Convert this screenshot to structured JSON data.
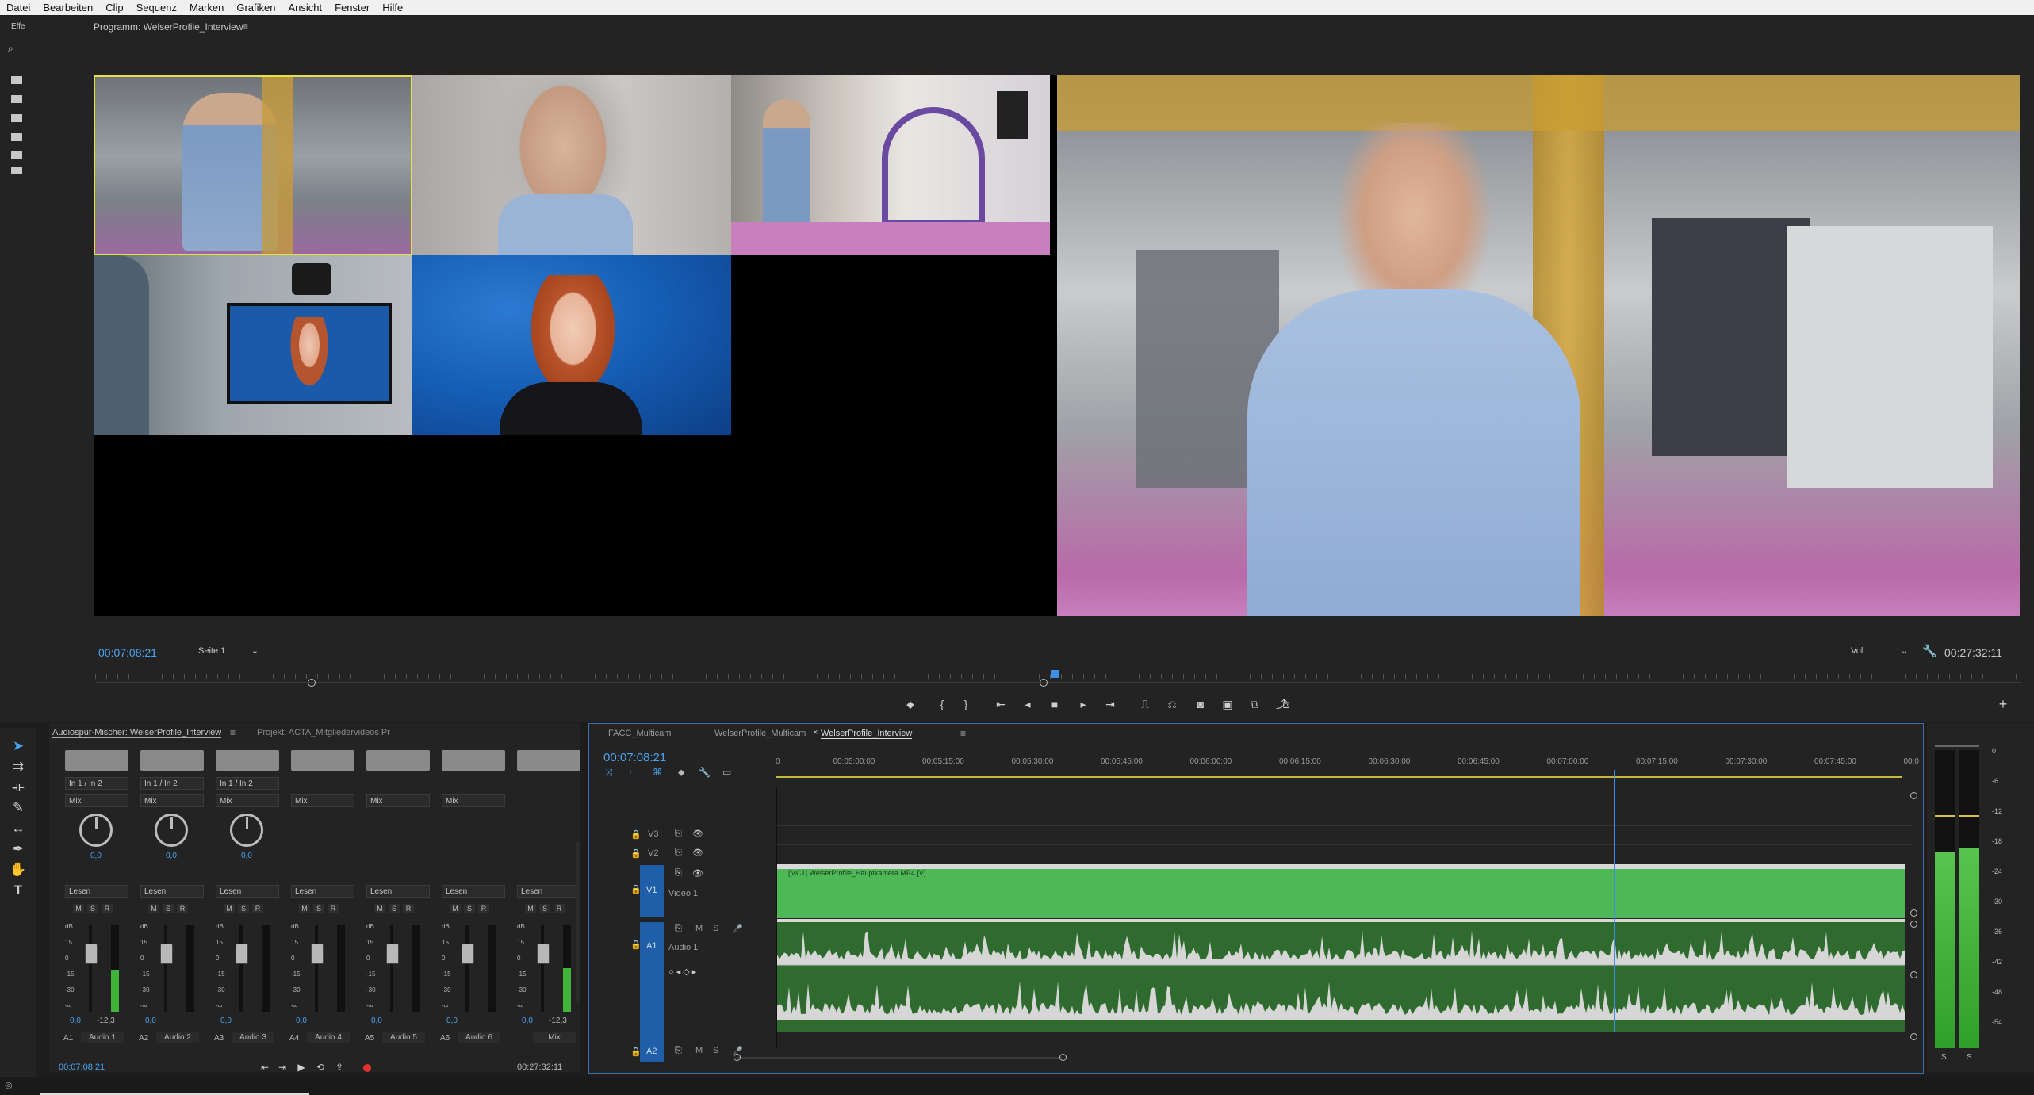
{
  "menu": [
    "Datei",
    "Bearbeiten",
    "Clip",
    "Sequenz",
    "Marken",
    "Grafiken",
    "Ansicht",
    "Fenster",
    "Hilfe"
  ],
  "left_panel": {
    "tab_label": "Effe"
  },
  "program_monitor": {
    "title": "Programm: WelserProfile_Interview",
    "timecode_current": "00:07:08:21",
    "page_dropdown": "Seite 1",
    "quality_dropdown": "Voll",
    "timecode_duration": "00:27:32:11",
    "camera_colors": [
      "#8c8f92",
      "#b9b4b0",
      "#a49a9e",
      "#6d7a84",
      "#1b5aa8"
    ],
    "main_view_colors": [
      "#7a7f84",
      "#c9a43a",
      "#7fa0c6"
    ]
  },
  "audio_mixer": {
    "tab_label": "Audiospur-Mischer: WelserProfile_Interview",
    "tab2_label": "Projekt: ACTA_Mitgliedervideos Pr",
    "channels": [
      {
        "input": "In 1 / In 2",
        "mode": "Mix",
        "pan": "0,0",
        "read": "Lesen",
        "meter_value": "0,0",
        "peak": "-12,3",
        "track": "A1",
        "name": "Audio 1",
        "level": 0.48,
        "has_knob": true
      },
      {
        "input": "In 1 / In 2",
        "mode": "Mix",
        "pan": "0,0",
        "read": "Lesen",
        "meter_value": "0,0",
        "peak": "",
        "track": "A2",
        "name": "Audio 2",
        "level": 0,
        "has_knob": true
      },
      {
        "input": "In 1 / In 2",
        "mode": "Mix",
        "pan": "0,0",
        "read": "Lesen",
        "meter_value": "0,0",
        "peak": "",
        "track": "A3",
        "name": "Audio 3",
        "level": 0,
        "has_knob": true
      },
      {
        "input": "",
        "mode": "Mix",
        "pan": "",
        "read": "Lesen",
        "meter_value": "0,0",
        "peak": "",
        "track": "A4",
        "name": "Audio 4",
        "level": 0,
        "has_knob": false
      },
      {
        "input": "",
        "mode": "Mix",
        "pan": "",
        "read": "Lesen",
        "meter_value": "0,0",
        "peak": "",
        "track": "A5",
        "name": "Audio 5",
        "level": 0,
        "has_knob": false
      },
      {
        "input": "",
        "mode": "Mix",
        "pan": "",
        "read": "Lesen",
        "meter_value": "0,0",
        "peak": "",
        "track": "A6",
        "name": "Audio 6",
        "level": 0,
        "has_knob": false
      },
      {
        "input": "",
        "mode": "",
        "pan": "",
        "read": "Lesen",
        "meter_value": "0,0",
        "peak": "-12,3",
        "track": "",
        "name": "Mix",
        "level": 0.5,
        "has_knob": false
      }
    ],
    "db_scale": [
      "dB",
      "15",
      "0",
      "-15",
      "-30",
      "-∞"
    ],
    "timecode_current": "00:07:08:21",
    "timecode_duration": "00:27:32:11"
  },
  "timeline": {
    "tabs": [
      "FACC_Multicam",
      "WelserProfile_Multicam",
      "WelserProfile_Interview"
    ],
    "active_tab_index": 2,
    "timecode": "00:07:08:21",
    "ruler_labels": [
      "0",
      "00:05:00:00",
      "00:05:15:00",
      "00:05:30:00",
      "00:05:45:00",
      "00:06:00:00",
      "00:06:15:00",
      "00:06:30:00",
      "00:06:45:00",
      "00:07:00:00",
      "00:07:15:00",
      "00:07:30:00",
      "00:07:45:00",
      "00:0"
    ],
    "playhead_fraction": 0.737,
    "tracks": {
      "v3": "V3",
      "v2": "V2",
      "v1": "V1",
      "v1_name": "Video 1",
      "a1": "A1",
      "a1_name": "Audio 1",
      "a2": "A2"
    },
    "track_buttons": {
      "mute": "M",
      "solo": "S"
    },
    "clip_label": "[MC1] WelserProfile_Hauptkamera.MP4 [V]",
    "clip_color": "#4eb856",
    "audio_color": "#2f6b2f"
  },
  "master_meter": {
    "scale": [
      "0",
      "-6",
      "-12",
      "-18",
      "-24",
      "-30",
      "-36",
      "-42",
      "-48",
      "-54"
    ],
    "solo_labels": [
      "S",
      "S"
    ],
    "left_level": 0.66,
    "right_level": 0.67
  }
}
